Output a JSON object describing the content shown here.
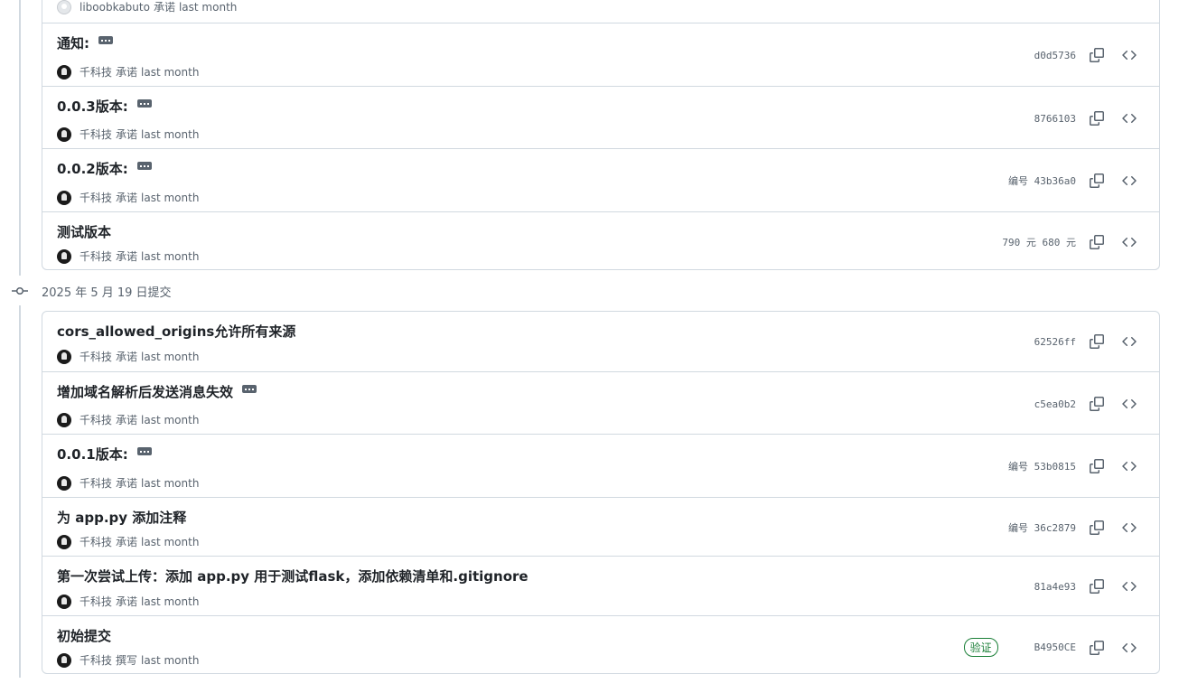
{
  "top_partial": {
    "author": "liboobkabuto",
    "action": "承诺",
    "time": "last month"
  },
  "groups": [
    {
      "commits": [
        {
          "title": "通知:",
          "has_ellipsis": true,
          "author": "千科技",
          "action": "承诺",
          "time": "last month",
          "sha": "d0d5736",
          "badge": ""
        },
        {
          "title": "0.0.3版本:",
          "has_ellipsis": true,
          "author": "千科技",
          "action": "承诺",
          "time": "last month",
          "sha": "8766103",
          "badge": ""
        },
        {
          "title": "0.0.2版本:",
          "has_ellipsis": true,
          "author": "千科技",
          "action": "承诺",
          "time": "last month",
          "sha": "编号 43b36a0",
          "badge": ""
        },
        {
          "title": "测试版本",
          "has_ellipsis": false,
          "author": "千科技",
          "action": "承诺",
          "time": "last month",
          "sha": "790 元 680 元",
          "badge": ""
        }
      ]
    },
    {
      "date_header": "2025 年 5 月 19 日提交",
      "commits": [
        {
          "title": "cors_allowed_origins允许所有来源",
          "has_ellipsis": false,
          "author": "千科技",
          "action": "承诺",
          "time": "last month",
          "sha": "62526ff",
          "badge": ""
        },
        {
          "title": "增加域名解析后发送消息失效",
          "has_ellipsis": true,
          "author": "千科技",
          "action": "承诺",
          "time": "last month",
          "sha": "c5ea0b2",
          "badge": ""
        },
        {
          "title": "0.0.1版本:",
          "has_ellipsis": true,
          "author": "千科技",
          "action": "承诺",
          "time": "last month",
          "sha": "编号 53b0815",
          "badge": ""
        },
        {
          "title": "为 app.py 添加注释",
          "has_ellipsis": false,
          "author": "千科技",
          "action": "承诺",
          "time": "last month",
          "sha": "编号 36c2879",
          "badge": ""
        },
        {
          "title": "第一次尝试上传：添加 app.py 用于测试flask，添加依赖清单和.gitignore",
          "has_ellipsis": false,
          "author": "千科技",
          "action": "承诺",
          "time": "last month",
          "sha": "81a4e93",
          "badge": ""
        },
        {
          "title": "初始提交",
          "has_ellipsis": false,
          "author": "千科技",
          "action": "撰写",
          "time": "last month",
          "sha": "B4950CE",
          "badge": "验证"
        }
      ]
    }
  ],
  "icons": {
    "copy": "copy-icon",
    "browse": "code-icon",
    "commit_node": "git-commit-icon",
    "ellipsis": "kebab-horizontal-icon"
  },
  "colors": {
    "border": "#d1d9e0",
    "muted": "#59636e",
    "verified": "#1a7f37"
  }
}
